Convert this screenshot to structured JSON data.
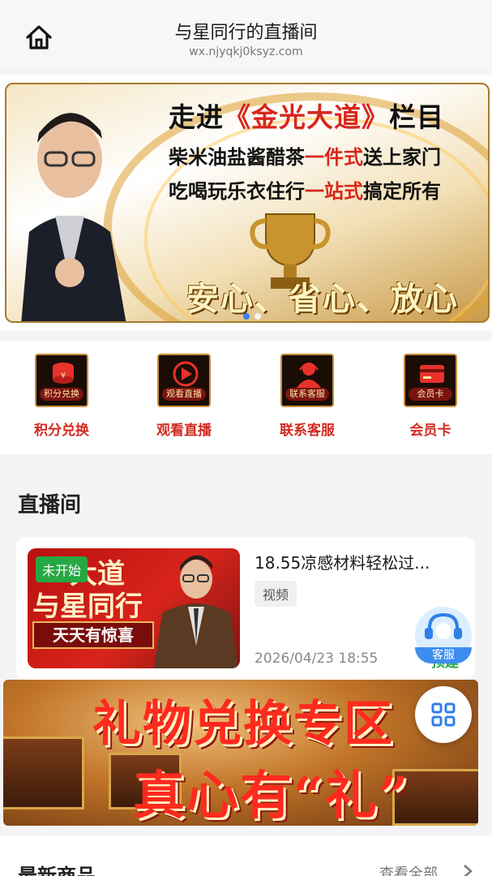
{
  "header": {
    "title": "与星同行的直播间",
    "url": "wx.njyqkj0ksyz.com",
    "home_icon": "home-icon"
  },
  "hero_banner": {
    "line1_prefix": "走进",
    "line1_highlight": "《金光大道》",
    "line1_suffix": "栏目",
    "line2_a": "柴米油盐酱醋茶",
    "line2_highlight": "一件式",
    "line2_b": "送上家门",
    "line3_a": "吃喝玩乐衣住行",
    "line3_highlight": "一站式",
    "line3_b": "搞定所有",
    "slogan": "安心、省心、放心",
    "active_slide": 1,
    "slide_count": 2
  },
  "quick_menu": [
    {
      "icon": "coins-icon",
      "tag": "积分兑换",
      "label": "积分兑换"
    },
    {
      "icon": "play-icon",
      "tag": "观看直播",
      "label": "观看直播"
    },
    {
      "icon": "support-agent-icon",
      "tag": "联系客服",
      "label": "联系客服"
    },
    {
      "icon": "card-icon",
      "tag": "会员卡",
      "label": "会员卡"
    }
  ],
  "live_section": {
    "title": "直播间",
    "card": {
      "thumb_line1": "大道",
      "thumb_line2": "与星同行",
      "thumb_line3": "天天有惊喜",
      "badge": "未开始",
      "title": "18.55凉感材料轻松过...",
      "tag": "视频",
      "date": "2026/04/23 18:55",
      "status": "预建"
    }
  },
  "gift_banner": {
    "line1": "礼物兑换专区",
    "line2": "真心有“礼”"
  },
  "floating": {
    "service_label": "客服",
    "service_icon": "headset-icon",
    "grid_icon": "grid-icon"
  },
  "products": {
    "title": "最新商品",
    "see_all": "查看全部"
  },
  "colors": {
    "accent_red": "#d22a20",
    "status_green": "#26a843",
    "service_blue": "#3d8df0"
  }
}
